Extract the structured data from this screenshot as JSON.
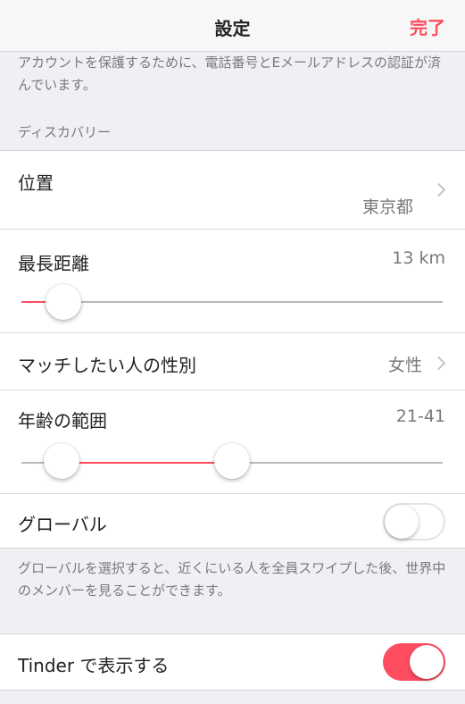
{
  "nav": {
    "title": "設定",
    "done_label": "完了"
  },
  "account_note": "アカウントを保護するために、電話番号とEメールアドレスの認証が済んでいます。",
  "discovery": {
    "header": "ディスカバリー",
    "location": {
      "label": "位置",
      "value": "東京都"
    },
    "max_distance": {
      "label": "最長距離",
      "value_text": "13 km",
      "fraction": 0.1
    },
    "gender": {
      "label": "マッチしたい人の性別",
      "value": "女性"
    },
    "age_range": {
      "label": "年齢の範囲",
      "value_text": "21-41",
      "low_fraction": 0.095,
      "high_fraction": 0.5
    },
    "global": {
      "label": "グローバル",
      "enabled": false
    }
  },
  "global_note": "グローバルを選択すると、近くにいる人を全員スワイプした後、世界中のメンバーを見ることができます。",
  "show_on_tinder": {
    "label": "Tinder で表示する",
    "enabled": true
  },
  "colors": {
    "accent": "#fd4d5e"
  }
}
